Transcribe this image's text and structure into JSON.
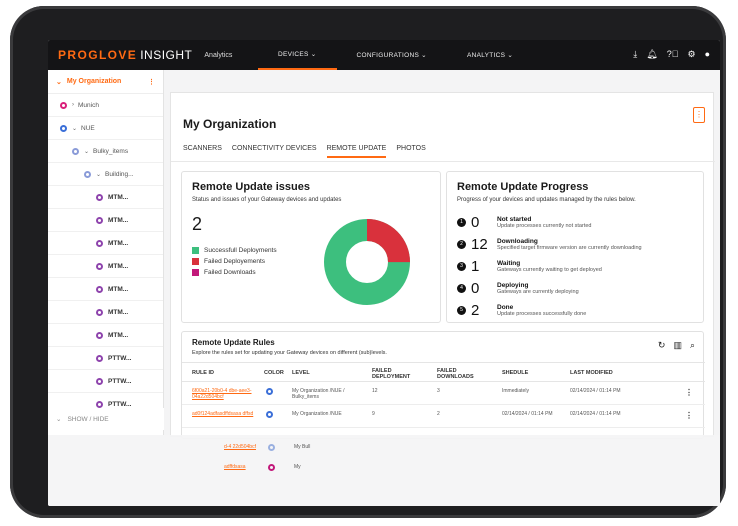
{
  "header": {
    "brand": "PROGLOVE",
    "brand_suffix": "INSIGHT",
    "analytics_tag": "Analytics",
    "nav": [
      {
        "label": "DEVICES ⌄"
      },
      {
        "label": "CONFIGURATIONS ⌄"
      },
      {
        "label": "ANALYTICS ⌄"
      }
    ],
    "icons": [
      "download-icon",
      "bell-icon",
      "help-icon",
      "settings-icon",
      "user-icon"
    ]
  },
  "sidebar": {
    "org": "My Organization",
    "items": [
      {
        "label": "Munich",
        "indent": 0
      },
      {
        "label": "NUE",
        "indent": 0
      },
      {
        "label": "Bulky_items",
        "indent": 1
      },
      {
        "label": "Building...",
        "indent": 2
      },
      {
        "label": "MTM...",
        "indent": 3
      },
      {
        "label": "MTM...",
        "indent": 3
      },
      {
        "label": "MTM...",
        "indent": 3
      },
      {
        "label": "MTM...",
        "indent": 3
      },
      {
        "label": "MTM...",
        "indent": 3
      },
      {
        "label": "MTM...",
        "indent": 3
      },
      {
        "label": "MTM...",
        "indent": 3
      },
      {
        "label": "PTTW...",
        "indent": 3
      },
      {
        "label": "PTTW...",
        "indent": 3
      },
      {
        "label": "PTTW...",
        "indent": 3
      }
    ],
    "show_hide": "SHOW / HIDE"
  },
  "main": {
    "title": "My Organization",
    "tabs": [
      "SCANNERS",
      "CONNECTIVITY DEVICES",
      "REMOTE UPDATE",
      "PHOTOS"
    ],
    "active_tab": "REMOTE UPDATE"
  },
  "issues": {
    "title": "Remote Update issues",
    "subtitle": "Status and issues of your Gateway devices and updates",
    "count": "2",
    "legend": [
      {
        "label": "Successfull Deployments",
        "color": "#3dbf7e"
      },
      {
        "label": "Failed Deployements",
        "color": "#d9313c"
      },
      {
        "label": "Failed Downloads",
        "color": "#c2187a"
      }
    ],
    "colors": {
      "success": "#3dbf7e",
      "failed_deploy": "#d9313c"
    }
  },
  "progress": {
    "title": "Remote Update Progress",
    "subtitle": "Progress of your devices and updates managed by the rules below.",
    "rows": [
      {
        "step": "1",
        "count": "0",
        "label": "Not started",
        "desc": "Update processes currently not started"
      },
      {
        "step": "2",
        "count": "12",
        "label": "Downloading",
        "desc": "Specified target firmware version are currently downloading"
      },
      {
        "step": "3",
        "count": "1",
        "label": "Waiting",
        "desc": "Gateways currently waiting to get deployed"
      },
      {
        "step": "4",
        "count": "0",
        "label": "Deploying",
        "desc": "Gateways are currently deploying"
      },
      {
        "step": "5",
        "count": "2",
        "label": "Done",
        "desc": "Update processes successfully done"
      }
    ]
  },
  "rules": {
    "title": "Remote Update Rules",
    "subtitle": "Explore the rules set for updating your Gateway devices on different (sub)levels.",
    "columns": [
      "RULE ID",
      "COLOR",
      "LEVEL",
      "FAILED DEPLOYMENT",
      "FAILED DOWNLOADS",
      "SHEDULE",
      "LAST MODIFIED"
    ],
    "rows": [
      {
        "id": "6f00a21-20b0-4 dbe-aee3-04a22d504bcf",
        "level": "My Organization /NUE / Bulky_items",
        "failed_deploy": "12",
        "failed_dl": "3",
        "schedule": "Immediately",
        "modified": "02/14/2024 / 01:14 PM"
      },
      {
        "id": "ad0f124adfasdffdsasa dffsd",
        "level": "My Organization /NUE",
        "failed_deploy": "9",
        "failed_dl": "2",
        "schedule": "02/14/2024 / 01:14 PM",
        "modified": "02/14/2024 / 01:14 PM"
      }
    ],
    "faded_rows": [
      {
        "id": "d-4 22d504bcf",
        "level": "My Bull"
      },
      {
        "id": "adffdsasa",
        "level": "My"
      }
    ]
  }
}
